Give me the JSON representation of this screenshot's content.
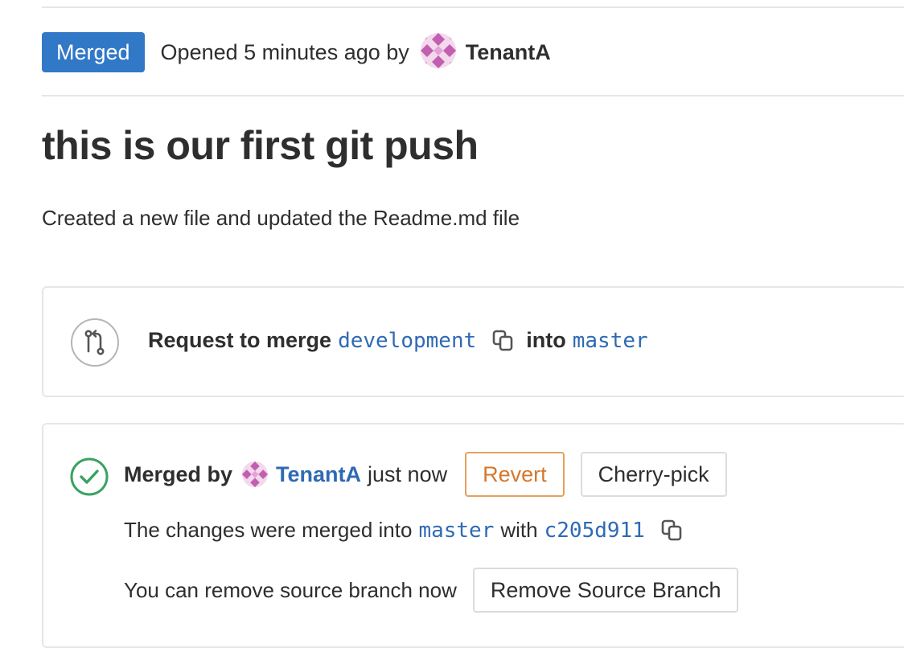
{
  "header": {
    "status_badge": "Merged",
    "opened_text": "Opened 5 minutes ago by",
    "author": "TenantA"
  },
  "title": "this is our first git push",
  "description": "Created a new file and updated the Readme.md file",
  "merge_request": {
    "prefix": "Request to merge",
    "source_branch": "development",
    "into_label": "into",
    "target_branch": "master"
  },
  "merged_widget": {
    "merged_by_label": "Merged by",
    "author": "TenantA",
    "time": "just now",
    "revert_label": "Revert",
    "cherry_pick_label": "Cherry-pick",
    "changes_prefix": "The changes were merged into",
    "target_branch": "master",
    "with_label": "with",
    "commit_sha": "c205d911",
    "remove_text": "You can remove source branch now",
    "remove_button_label": "Remove Source Branch"
  },
  "colors": {
    "badge_blue": "#3178c7",
    "link_blue": "#2f6ab4",
    "revert_orange": "#d5772e",
    "success_green": "#3aa261"
  },
  "icons": {
    "merge_request": "merge-request-icon",
    "copy": "copy-icon",
    "check": "check-circle-icon",
    "avatar": "identicon-avatar"
  }
}
